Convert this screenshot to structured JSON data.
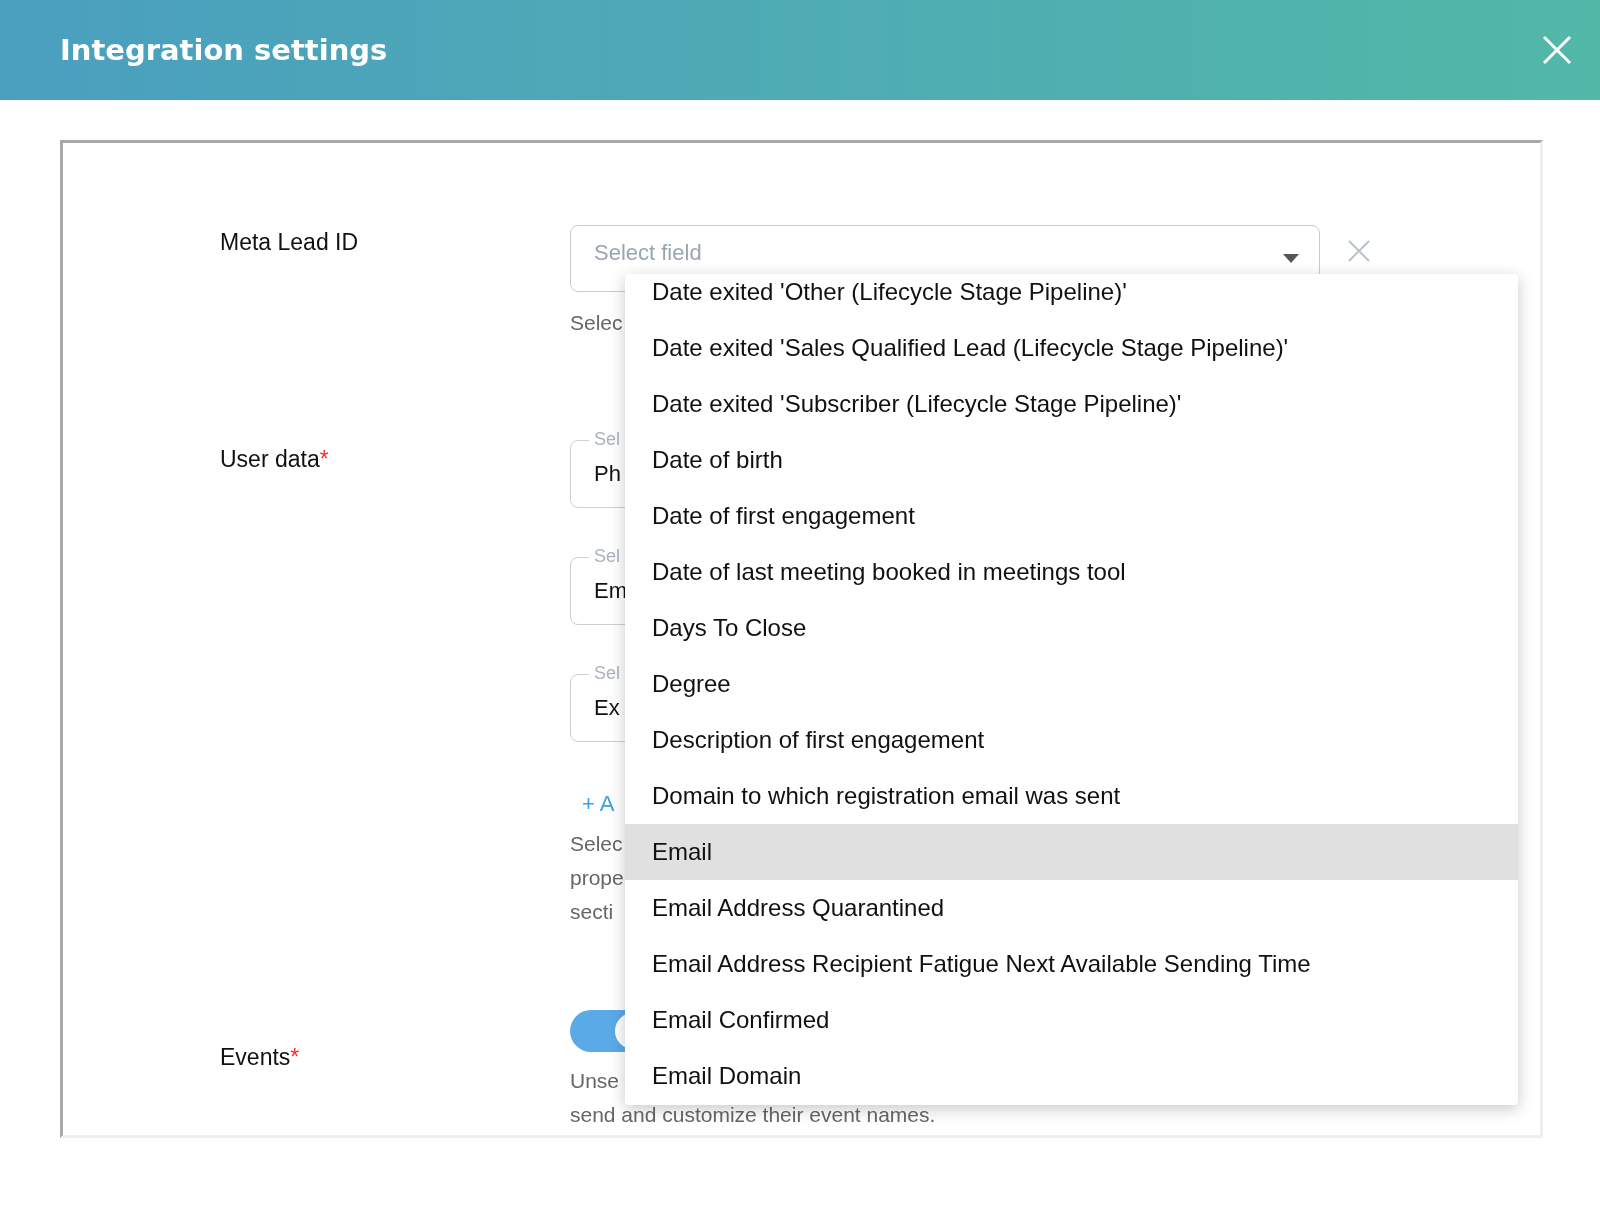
{
  "header": {
    "title": "Integration settings"
  },
  "form": {
    "meta_lead_id": {
      "label": "Meta Lead ID",
      "placeholder": "Select field",
      "help": "Selec"
    },
    "user_data": {
      "label": "User data",
      "required_mark": "*",
      "fields": [
        {
          "label": "Sel",
          "value": "Ph"
        },
        {
          "label": "Sel",
          "value": "Em"
        },
        {
          "label": "Sel",
          "value": "Ex"
        }
      ],
      "add_link": "+ A",
      "help": [
        "Selec",
        "prope",
        "secti"
      ]
    },
    "events": {
      "label": "Events",
      "required_mark": "*",
      "toggle": {
        "on": true
      },
      "help": [
        "Unse",
        "send and customize their event names."
      ]
    }
  },
  "dropdown": {
    "items": [
      {
        "label": "Date exited 'Other (Lifecycle Stage Pipeline)'",
        "selected": false
      },
      {
        "label": "Date exited 'Sales Qualified Lead (Lifecycle Stage Pipeline)'",
        "selected": false
      },
      {
        "label": "Date exited 'Subscriber (Lifecycle Stage Pipeline)'",
        "selected": false
      },
      {
        "label": "Date of birth",
        "selected": false
      },
      {
        "label": "Date of first engagement",
        "selected": false
      },
      {
        "label": "Date of last meeting booked in meetings tool",
        "selected": false
      },
      {
        "label": "Days To Close",
        "selected": false
      },
      {
        "label": "Degree",
        "selected": false
      },
      {
        "label": "Description of first engagement",
        "selected": false
      },
      {
        "label": "Domain to which registration email was sent",
        "selected": false
      },
      {
        "label": "Email",
        "selected": true
      },
      {
        "label": "Email Address Quarantined",
        "selected": false
      },
      {
        "label": "Email Address Recipient Fatigue Next Available Sending Time",
        "selected": false
      },
      {
        "label": "Email Confirmed",
        "selected": false
      },
      {
        "label": "Email Domain",
        "selected": false
      }
    ]
  }
}
